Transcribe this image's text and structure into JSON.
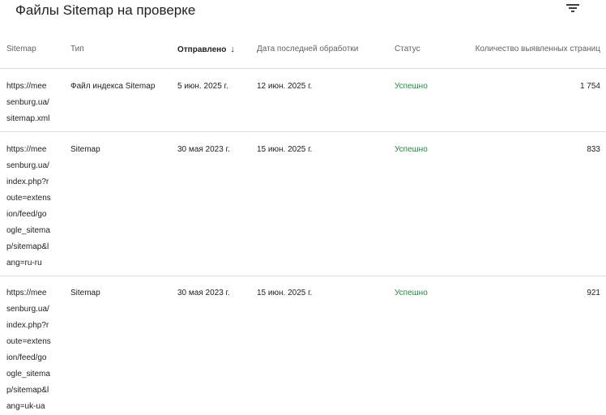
{
  "header": {
    "title": "Файлы Sitemap на проверке",
    "filter_icon": "filter-list-icon"
  },
  "table": {
    "columns": [
      "Sitemap",
      "Тип",
      "Отправлено",
      "Дата последней обработки",
      "Статус",
      "Количество выявленных страниц"
    ],
    "sort_icon": "arrow-down-icon",
    "rows": [
      {
        "sitemap_lines": [
          "https://mee",
          "senburg.ua/",
          "sitemap.xml"
        ],
        "type": "Файл индекса Sitemap",
        "submitted": "5 июн. 2025 г.",
        "last_processed": "12 июн. 2025 г.",
        "status": "Успешно",
        "pages": "1 754"
      },
      {
        "sitemap_lines": [
          "https://mee",
          "senburg.ua/",
          "index.php?r",
          "oute=extens",
          "ion/feed/go",
          "ogle_sitema",
          "p/sitemap&l",
          "ang=ru-ru"
        ],
        "type": "Sitemap",
        "submitted": "30 мая 2023 г.",
        "last_processed": "15 июн. 2025 г.",
        "status": "Успешно",
        "pages": "833"
      },
      {
        "sitemap_lines": [
          "https://mee",
          "senburg.ua/",
          "index.php?r",
          "oute=extens",
          "ion/feed/go",
          "ogle_sitema",
          "p/sitemap&l",
          "ang=uk-ua"
        ],
        "type": "Sitemap",
        "submitted": "30 мая 2023 г.",
        "last_processed": "15 июн. 2025 г.",
        "status": "Успешно",
        "pages": "921"
      }
    ]
  },
  "colors": {
    "status_success": "#1e8e3e",
    "divider": "#e0e0e0"
  }
}
